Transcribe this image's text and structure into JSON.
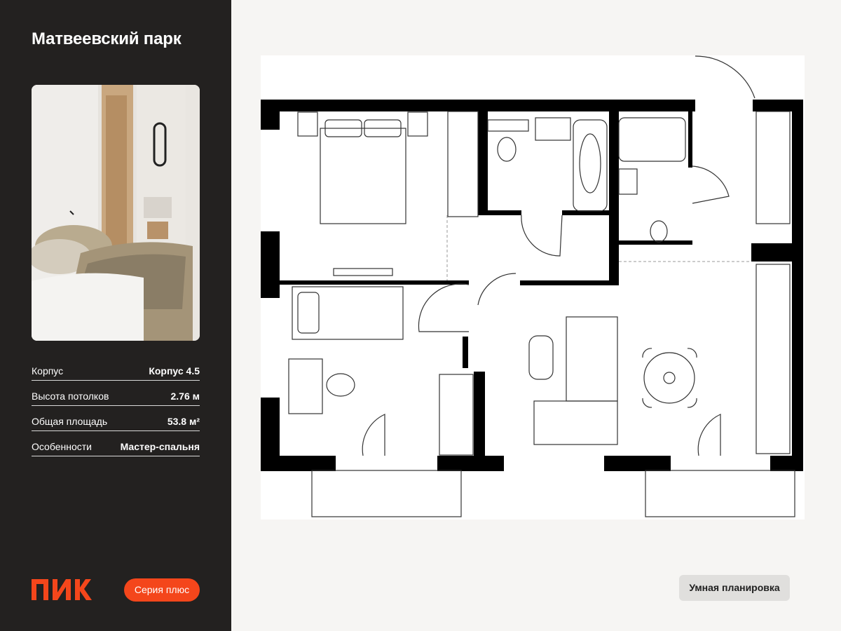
{
  "project": {
    "title": "Матвеевский парк"
  },
  "specs": [
    {
      "label": "Корпус",
      "value": "Корпус 4.5"
    },
    {
      "label": "Высота потолков",
      "value": "2.76 м"
    },
    {
      "label": "Общая площадь",
      "value": "53.8 м²"
    },
    {
      "label": "Особенности",
      "value": "Мастер-спальня"
    }
  ],
  "brand": {
    "logo_text": "ПИК",
    "series_label": "Серия плюс",
    "accent": "#f4461b"
  },
  "plan": {
    "smart_label": "Умная планировка"
  },
  "colors": {
    "sidebar": "#232120",
    "background": "#f6f5f3",
    "wall": "#000000"
  }
}
